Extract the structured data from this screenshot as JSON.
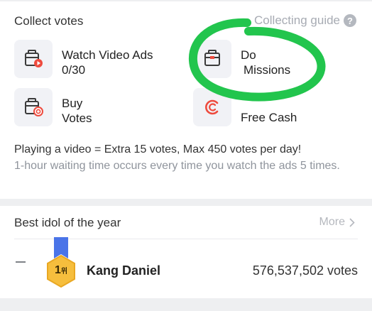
{
  "collect": {
    "title": "Collect votes",
    "guide_label": "Collecting guide",
    "options": [
      {
        "id": "watch-video-ads",
        "line1": "Watch Video Ads",
        "line2": "0/30",
        "icon": "video-play-icon"
      },
      {
        "id": "do-missions",
        "line1": "Do",
        "line2": "Missions",
        "icon": "mission-box-icon"
      },
      {
        "id": "buy-votes",
        "line1": "Buy",
        "line2": "Votes",
        "icon": "coin-box-icon"
      },
      {
        "id": "free-cash",
        "line1": "Free Cash",
        "line2": "",
        "icon": "cash-icon"
      }
    ],
    "note_main": "Playing a video = Extra 15 votes, Max 450 votes per day!",
    "note_sub": "1-hour waiting time occurs every time you watch the ads 5 times."
  },
  "best_idol": {
    "title": "Best idol of the year",
    "more_label": "More",
    "entry": {
      "rank_number": "1",
      "rank_unit": "위",
      "name": "Kang Daniel",
      "votes": "576,537,502 votes",
      "change": "—"
    }
  },
  "colors": {
    "accent_red": "#ee4b3e",
    "icon_dark": "#3b3b3b",
    "medal_gold": "#f6be3d",
    "ribbon_blue": "#4a74e8",
    "scribble_green": "#22c54d"
  }
}
